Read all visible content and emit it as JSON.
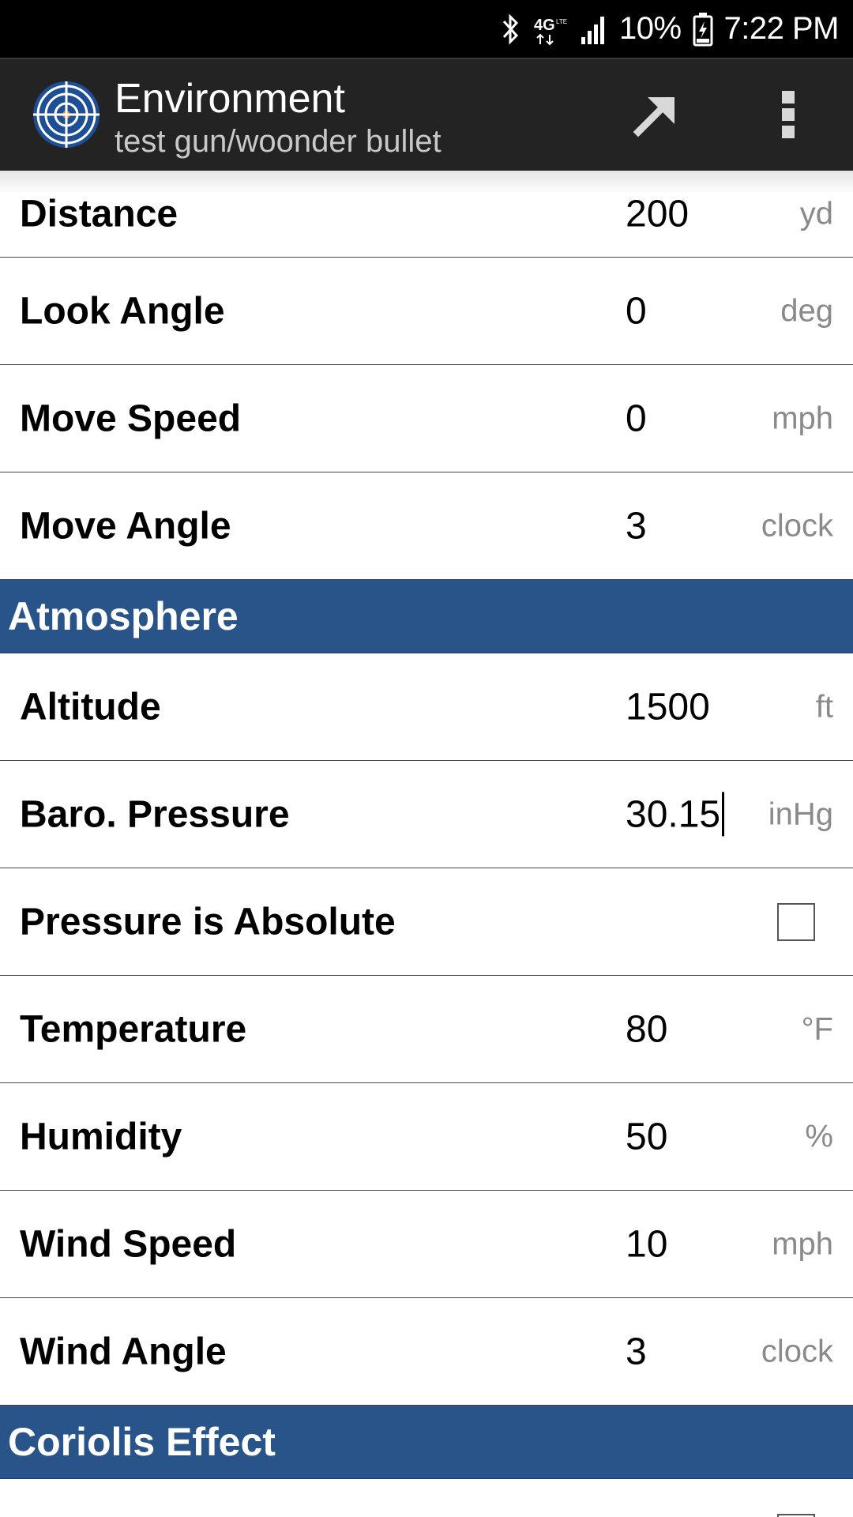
{
  "status_bar": {
    "network": "4G",
    "battery": "10%",
    "time": "7:22 PM",
    "icons": [
      "bluetooth-icon",
      "4g-lte-icon",
      "signal-icon",
      "battery-charging-icon"
    ]
  },
  "action_bar": {
    "title": "Environment",
    "subtitle": "test gun/woonder bullet",
    "icons": [
      "app-target-icon",
      "share-arrow-icon",
      "overflow-menu-icon"
    ]
  },
  "rows_top": [
    {
      "label": "Distance",
      "value": "200",
      "unit": "yd"
    },
    {
      "label": "Look Angle",
      "value": "0",
      "unit": "deg"
    },
    {
      "label": "Move Speed",
      "value": "0",
      "unit": "mph"
    },
    {
      "label": "Move Angle",
      "value": "3",
      "unit": "clock"
    }
  ],
  "sections": {
    "atmosphere": "Atmosphere",
    "coriolis": "Coriolis Effect"
  },
  "atmosphere": {
    "altitude": {
      "label": "Altitude",
      "value": "1500",
      "unit": "ft"
    },
    "baro_pressure": {
      "label": "Baro. Pressure",
      "value": "30.15",
      "unit": "inHg"
    },
    "pressure_absolute": {
      "label": "Pressure is Absolute",
      "checked": false
    },
    "temperature": {
      "label": "Temperature",
      "value": "80",
      "unit": "°F"
    },
    "humidity": {
      "label": "Humidity",
      "value": "50",
      "unit": "%"
    },
    "wind_speed": {
      "label": "Wind Speed",
      "value": "10",
      "unit": "mph"
    },
    "wind_angle": {
      "label": "Wind Angle",
      "value": "3",
      "unit": "clock"
    }
  },
  "colors": {
    "section_header": "#28548a",
    "action_bar": "#232323",
    "status_bar": "#000000"
  }
}
